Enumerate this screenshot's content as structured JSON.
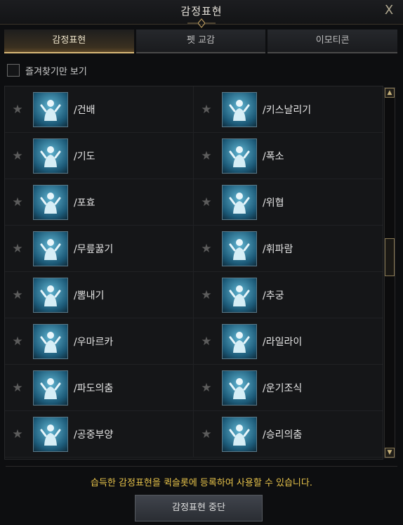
{
  "window": {
    "title": "감정표현",
    "close_label": "X"
  },
  "tabs": [
    {
      "label": "감정표현",
      "active": true
    },
    {
      "label": "펫 교감",
      "active": false
    },
    {
      "label": "이모티콘",
      "active": false
    }
  ],
  "favorites_filter": {
    "label": "즐겨찾기만 보기",
    "checked": false
  },
  "emotes": [
    {
      "command": "/건배",
      "icon": "cheers-icon",
      "favorite": false
    },
    {
      "command": "/키스날리기",
      "icon": "blow-kiss-icon",
      "favorite": false
    },
    {
      "command": "/기도",
      "icon": "pray-icon",
      "favorite": false
    },
    {
      "command": "/폭소",
      "icon": "laugh-icon",
      "favorite": false
    },
    {
      "command": "/포효",
      "icon": "roar-icon",
      "favorite": false
    },
    {
      "command": "/위협",
      "icon": "threaten-icon",
      "favorite": false
    },
    {
      "command": "/무릎꿇기",
      "icon": "kneel-icon",
      "favorite": false
    },
    {
      "command": "/휘파람",
      "icon": "whistle-icon",
      "favorite": false
    },
    {
      "command": "/뽐내기",
      "icon": "show-off-icon",
      "favorite": false
    },
    {
      "command": "/추궁",
      "icon": "interrogate-icon",
      "favorite": false
    },
    {
      "command": "/우마르카",
      "icon": "umarka-dance-icon",
      "favorite": false
    },
    {
      "command": "/라일라이",
      "icon": "lailai-dance-icon",
      "favorite": false
    },
    {
      "command": "/파도의춤",
      "icon": "wave-dance-icon",
      "favorite": false
    },
    {
      "command": "/운기조식",
      "icon": "meditate-breath-icon",
      "favorite": false
    },
    {
      "command": "/공중부양",
      "icon": "levitate-icon",
      "favorite": false
    },
    {
      "command": "/승리의춤",
      "icon": "victory-dance-icon",
      "favorite": false
    }
  ],
  "notice": "습득한 감정표현을 퀵슬롯에 등록하여 사용할 수 있습니다.",
  "stop_button": "감정표현 중단",
  "colors": {
    "accent_gold": "#d8b878",
    "notice_yellow": "#e6c24a",
    "icon_blue": "#5fb3d0"
  }
}
